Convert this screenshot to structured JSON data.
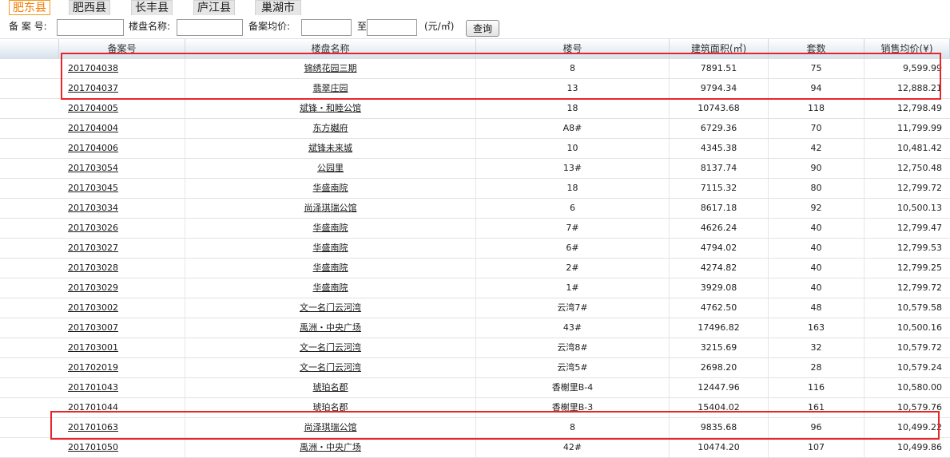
{
  "tabs": [
    "肥东县",
    "肥西县",
    "长丰县",
    "庐江县",
    "巢湖市"
  ],
  "search": {
    "record_no_label": "备 案 号:",
    "name_label": "楼盘名称:",
    "avg_price_label": "备案均价:",
    "to_label": "至",
    "unit_label": "(元/㎡)",
    "query_button": "查询",
    "record_no_value": "",
    "name_value": "",
    "price_from_value": "",
    "price_to_value": ""
  },
  "table": {
    "headers": [
      "备案号",
      "楼盘名称",
      "楼号",
      "建筑面积(㎡)",
      "套数",
      "销售均价(¥)"
    ],
    "rows": [
      {
        "id": "201704038",
        "name": "锦绣花园三期",
        "building": "8",
        "area": "7891.51",
        "units": "75",
        "price": "9,599.99"
      },
      {
        "id": "201704037",
        "name": "翡翠庄园",
        "building": "13",
        "area": "9794.34",
        "units": "94",
        "price": "12,888.21"
      },
      {
        "id": "201704005",
        "name": "斌锋・和睦公馆",
        "building": "18",
        "area": "10743.68",
        "units": "118",
        "price": "12,798.49"
      },
      {
        "id": "201704004",
        "name": "东方樾府",
        "building": "A8#",
        "area": "6729.36",
        "units": "70",
        "price": "11,799.99"
      },
      {
        "id": "201704006",
        "name": "斌锋未来城",
        "building": "10",
        "area": "4345.38",
        "units": "42",
        "price": "10,481.42"
      },
      {
        "id": "201703054",
        "name": "公园里",
        "building": "13#",
        "area": "8137.74",
        "units": "90",
        "price": "12,750.48"
      },
      {
        "id": "201703045",
        "name": "华盛南院",
        "building": "18",
        "area": "7115.32",
        "units": "80",
        "price": "12,799.72"
      },
      {
        "id": "201703034",
        "name": "尚泽琪瑞公馆",
        "building": "6",
        "area": "8617.18",
        "units": "92",
        "price": "10,500.13"
      },
      {
        "id": "201703026",
        "name": "华盛南院",
        "building": "7#",
        "area": "4626.24",
        "units": "40",
        "price": "12,799.47"
      },
      {
        "id": "201703027",
        "name": "华盛南院",
        "building": "6#",
        "area": "4794.02",
        "units": "40",
        "price": "12,799.53"
      },
      {
        "id": "201703028",
        "name": "华盛南院",
        "building": "2#",
        "area": "4274.82",
        "units": "40",
        "price": "12,799.25"
      },
      {
        "id": "201703029",
        "name": "华盛南院",
        "building": "1#",
        "area": "3929.08",
        "units": "40",
        "price": "12,799.72"
      },
      {
        "id": "201703002",
        "name": "文一名门云河湾",
        "building": "云湾7#",
        "area": "4762.50",
        "units": "48",
        "price": "10,579.58"
      },
      {
        "id": "201703007",
        "name": "禹洲・中央广场",
        "building": "43#",
        "area": "17496.82",
        "units": "163",
        "price": "10,500.16"
      },
      {
        "id": "201703001",
        "name": "文一名门云河湾",
        "building": "云湾8#",
        "area": "3215.69",
        "units": "32",
        "price": "10,579.72"
      },
      {
        "id": "201702019",
        "name": "文一名门云河湾",
        "building": "云湾5#",
        "area": "2698.20",
        "units": "28",
        "price": "10,579.24"
      },
      {
        "id": "201701043",
        "name": "琥珀名郡",
        "building": "香榭里B-4",
        "area": "12447.96",
        "units": "116",
        "price": "10,580.00"
      },
      {
        "id": "201701044",
        "name": "琥珀名郡",
        "building": "香榭里B-3",
        "area": "15404.02",
        "units": "161",
        "price": "10,579.76"
      },
      {
        "id": "201701063",
        "name": "尚泽琪瑞公馆",
        "building": "8",
        "area": "9835.68",
        "units": "96",
        "price": "10,499.22"
      },
      {
        "id": "201701050",
        "name": "禹洲・中央广场",
        "building": "42#",
        "area": "10474.20",
        "units": "107",
        "price": "10,499.86"
      }
    ]
  },
  "colors": {
    "active_tab": "#f07d00",
    "highlight_box": "#e8262a"
  }
}
